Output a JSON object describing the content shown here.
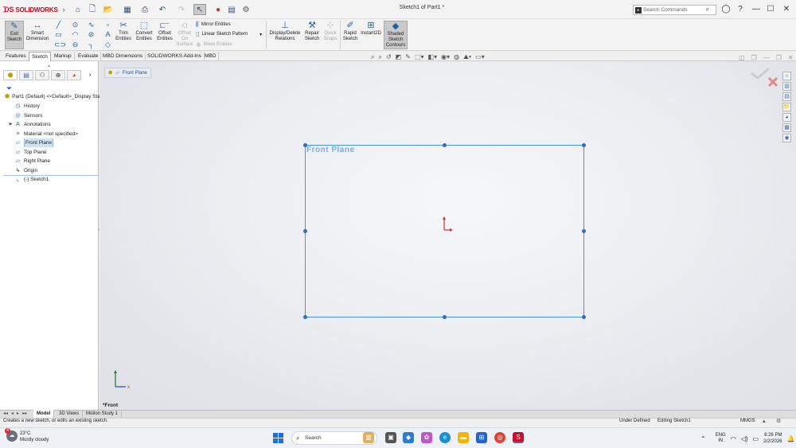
{
  "app": {
    "logo_text": "SOLIDWORKS",
    "document_title": "Sketch1 of Part1 *"
  },
  "search": {
    "placeholder": "Search Commands"
  },
  "ribbon": {
    "exit_sketch": "Exit Sketch",
    "smart_dimension": "Smart Dimension",
    "trim_entities": "Trim Entities",
    "convert_entities": "Convert Entities",
    "offset_entities": "Offset Entities",
    "offset_on_surface": "Offset On Surface",
    "mirror_entities": "Mirror Entities",
    "linear_sketch_pattern": "Linear Sketch Pattern",
    "move_entities": "Move Entities",
    "display_delete_relations": "Display/Delete Relations",
    "repair_sketch": "Repair Sketch",
    "quick_snaps": "Quick Snaps",
    "rapid_sketch": "Rapid Sketch",
    "instant2d": "Instant2D",
    "shaded_sketch_contours": "Shaded Sketch Contours"
  },
  "tabs": [
    "Features",
    "Sketch",
    "Markup",
    "Evaluate",
    "MBD Dimensions",
    "SOLIDWORKS Add-Ins",
    "MBD"
  ],
  "active_tab": "Sketch",
  "tree": {
    "root": "Part1 (Default) <<Default>_Display Sta",
    "items": [
      "History",
      "Sensors",
      "Annotations",
      "Material <not specified>",
      "Front Plane",
      "Top Plane",
      "Right Plane",
      "Origin"
    ],
    "sketch": "(-) Sketch1",
    "selected": "Front Plane"
  },
  "breadcrumb": {
    "label": "Front Plane"
  },
  "viewport": {
    "plane_label": "Front Plane",
    "view_label": "*Front"
  },
  "bottom_tabs": [
    "Model",
    "3D Views",
    "Motion Study 1"
  ],
  "active_bottom_tab": "Model",
  "status": {
    "hint": "Creates a new sketch, or edits an existing sketch.",
    "state": "Under Defined",
    "mode": "Editing Sketch1",
    "units": "MMGS"
  },
  "taskbar": {
    "weather_temp": "23°C",
    "weather_desc": "Mostly cloudy",
    "weather_badge": "4",
    "search": "Search",
    "lang1": "ENG",
    "lang2": "IN",
    "time": "8:26 PM",
    "date": "2/2/2026"
  },
  "colors": {
    "plane_border": "#4c93d8",
    "selection_blue": "#2a6fc4",
    "brand_red": "#c8102e",
    "origin_red": "#d32f2f"
  }
}
